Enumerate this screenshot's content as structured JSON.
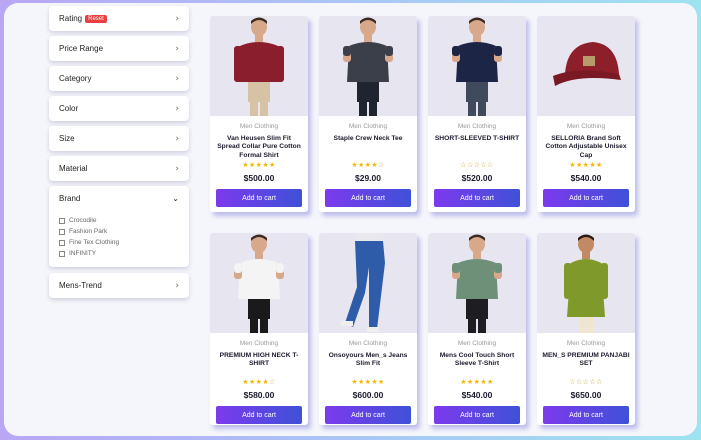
{
  "sidebar": {
    "rating_label": "Rating",
    "reset_label": "Reset",
    "filters": [
      "Price Range",
      "Category",
      "Color",
      "Size",
      "Material"
    ],
    "brand_label": "Brand",
    "brands": [
      "Crocodile",
      "Fashion Park",
      "Fine Tex Clothing",
      "INFINITY"
    ],
    "mens_trend_label": "Mens-Trend"
  },
  "products": [
    {
      "category": "Men Clothing",
      "title": "Van Heusen Slim Fit Spread Collar Pure Cotton Formal Shirt",
      "rating": 5,
      "price": "$500.00",
      "button": "Add to cart",
      "image": "maroon-shirt-model"
    },
    {
      "category": "Men Clothing",
      "title": "Staple Crew Neck Tee",
      "rating": 4,
      "price": "$29.00",
      "button": "Add to cart",
      "image": "grey-tee-model"
    },
    {
      "category": "Men Clothing",
      "title": "SHORT-SLEEVED T-SHIRT",
      "rating": 0,
      "price": "$520.00",
      "button": "Add to cart",
      "image": "navy-tee-model"
    },
    {
      "category": "Men Clothing",
      "title": "SELLORIA Brand Soft Cotton Adjustable Unisex Cap",
      "rating": 5,
      "price": "$540.00",
      "button": "Add to cart",
      "image": "red-cap"
    },
    {
      "category": "Men Clothing",
      "title": "PREMIUM HIGH NECK T-SHIRT",
      "rating": 4,
      "price": "$580.00",
      "button": "Add to cart",
      "image": "white-tee-model"
    },
    {
      "category": "Men Clothing",
      "title": "Onsoyours Men_s Jeans Slim Fit",
      "rating": 5,
      "price": "$600.00",
      "button": "Add to cart",
      "image": "blue-jeans"
    },
    {
      "category": "Men Clothing",
      "title": "Mens Cool Touch Short Sleeve T-Shirt",
      "rating": 5,
      "price": "$540.00",
      "button": "Add to cart",
      "image": "green-tee-model"
    },
    {
      "category": "Men Clothing",
      "title": "MEN_S PREMIUM PANJABI SET",
      "rating": 0,
      "price": "$650.00",
      "button": "Add to cart",
      "image": "olive-panjabi-model"
    }
  ],
  "colors": {
    "accent_start": "#7c3aed",
    "accent_end": "#3f51d8",
    "star": "#f2b705",
    "reset_badge": "#e8413d"
  }
}
